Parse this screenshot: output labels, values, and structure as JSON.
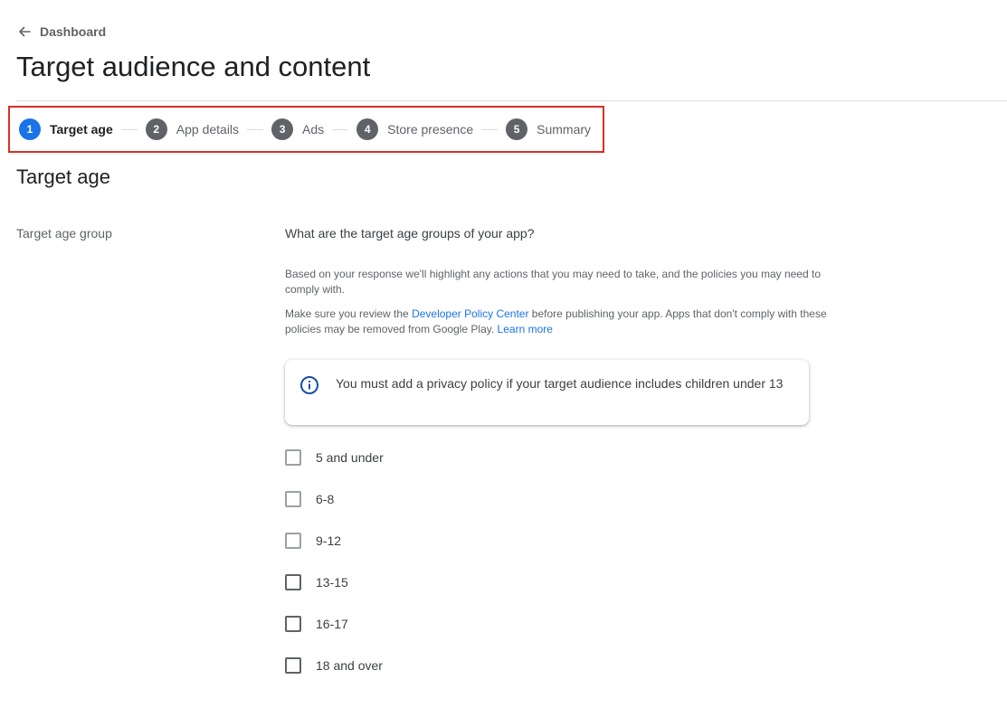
{
  "header": {
    "back_label": "Dashboard",
    "title": "Target audience and content"
  },
  "stepper": {
    "steps": [
      {
        "number": "1",
        "label": "Target age",
        "active": true
      },
      {
        "number": "2",
        "label": "App details",
        "active": false
      },
      {
        "number": "3",
        "label": "Ads",
        "active": false
      },
      {
        "number": "4",
        "label": "Store presence",
        "active": false
      },
      {
        "number": "5",
        "label": "Summary",
        "active": false
      }
    ],
    "highlight_color": "#d93025",
    "active_color": "#1a73e8"
  },
  "section": {
    "title": "Target age",
    "field_label": "Target age group",
    "question": "What are the target age groups of your app?",
    "help_1": "Based on your response we'll highlight any actions that you may need to take, and the policies you may need to comply with.",
    "help_2_prefix": "Make sure you review the ",
    "help_2_link": "Developer Policy Center",
    "help_2_suffix": " before publishing your app. Apps that don't comply with these policies may be removed from Google Play. ",
    "help_2_learn_more": "Learn more",
    "info_icon": "info-icon",
    "info_text": "You must add a privacy policy if your target audience includes children under 13"
  },
  "age_groups": [
    {
      "label": "5 and under",
      "checked": false
    },
    {
      "label": "6-8",
      "checked": false
    },
    {
      "label": "9-12",
      "checked": false
    },
    {
      "label": "13-15",
      "checked": false
    },
    {
      "label": "16-17",
      "checked": false
    },
    {
      "label": "18 and over",
      "checked": false
    }
  ]
}
